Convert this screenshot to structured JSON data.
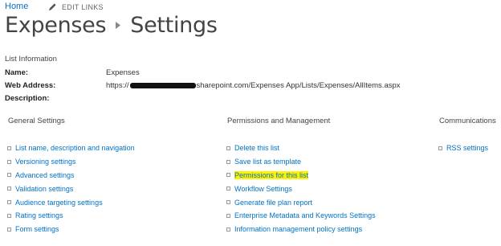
{
  "nav": {
    "home": "Home",
    "edit_links": "EDIT LINKS"
  },
  "title": {
    "parent": "Expenses",
    "current": "Settings"
  },
  "list_info": {
    "heading": "List Information",
    "name_label": "Name:",
    "name_value": "Expenses",
    "web_address_label": "Web Address:",
    "web_address_prefix": "https://",
    "web_address_suffix": "sharepoint.com/Expenses App/Lists/Expenses/AllItems.aspx",
    "description_label": "Description:"
  },
  "columns": {
    "general": {
      "heading": "General Settings",
      "items": [
        "List name, description and navigation",
        "Versioning settings",
        "Advanced settings",
        "Validation settings",
        "Audience targeting settings",
        "Rating settings",
        "Form settings"
      ]
    },
    "permissions": {
      "heading": "Permissions and Management",
      "items": [
        "Delete this list",
        "Save list as template",
        "Permissions for this list",
        "Workflow Settings",
        "Generate file plan report",
        "Enterprise Metadata and Keywords Settings",
        "Information management policy settings"
      ],
      "highlighted_item": "Permissions for this list",
      "highlight_color": "#fff200"
    },
    "communications": {
      "heading": "Communications",
      "items": [
        "RSS settings"
      ]
    }
  },
  "colors": {
    "link": "#0072c6",
    "text": "#333333",
    "title": "#444444"
  }
}
